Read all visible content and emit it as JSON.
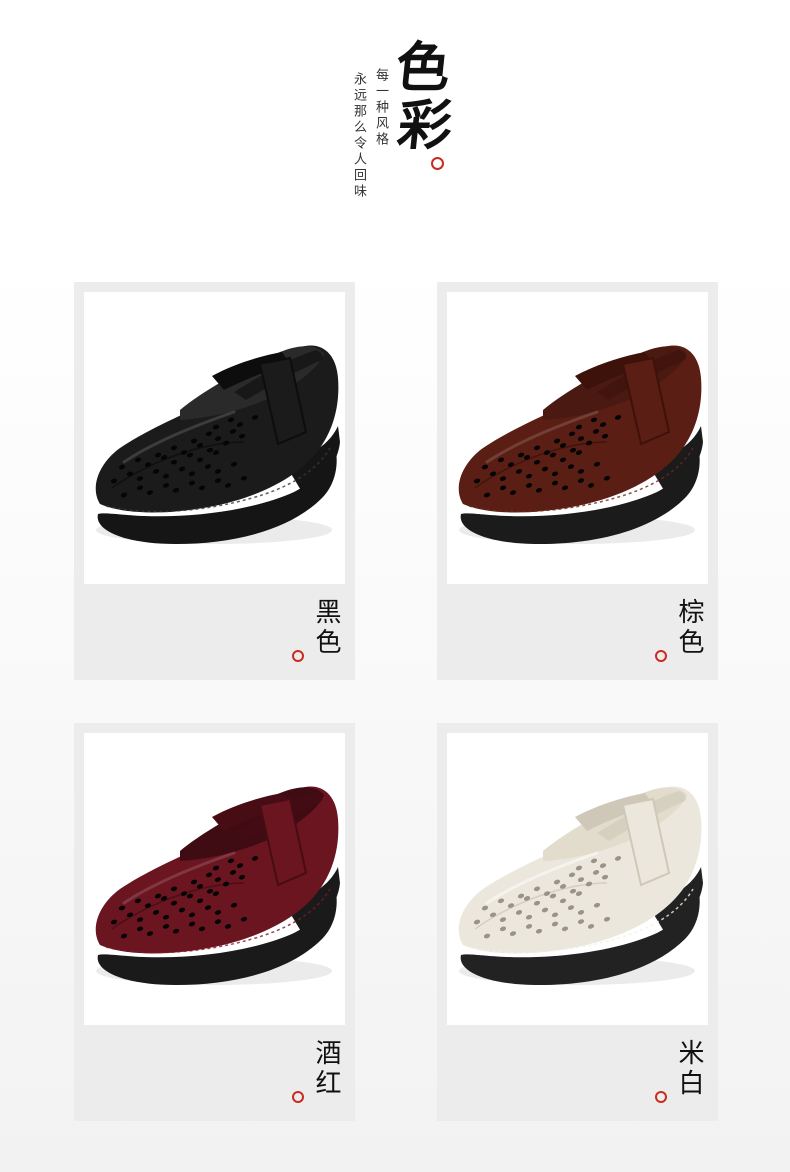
{
  "header": {
    "title_chars": [
      "色",
      "彩"
    ],
    "subtitle_line1": "每一种风格",
    "subtitle_line2": "永远那么令人回味"
  },
  "colors": {
    "accent_red": "#cc2a1e"
  },
  "products": [
    {
      "label": "黑色",
      "upper": "#1b1b1b",
      "upper_shade": "#0d0d0d",
      "inner": "#2a2a2a",
      "sole": "#151515",
      "stitch": "#3a3a3a"
    },
    {
      "label": "棕色",
      "upper": "#5a1e14",
      "upper_shade": "#3c120b",
      "inner": "#4a1a12",
      "sole": "#1b1b1b",
      "stitch": "#6b2a1e"
    },
    {
      "label": "酒红",
      "upper": "#6b1520",
      "upper_shade": "#470c14",
      "inner": "#3e0c12",
      "sole": "#1a1a1a",
      "stitch": "#7a1c28"
    },
    {
      "label": "米白",
      "upper": "#ece7dc",
      "upper_shade": "#cfc8b8",
      "inner": "#e2dccd",
      "sole": "#222222",
      "stitch": "#f4f0e6"
    }
  ]
}
